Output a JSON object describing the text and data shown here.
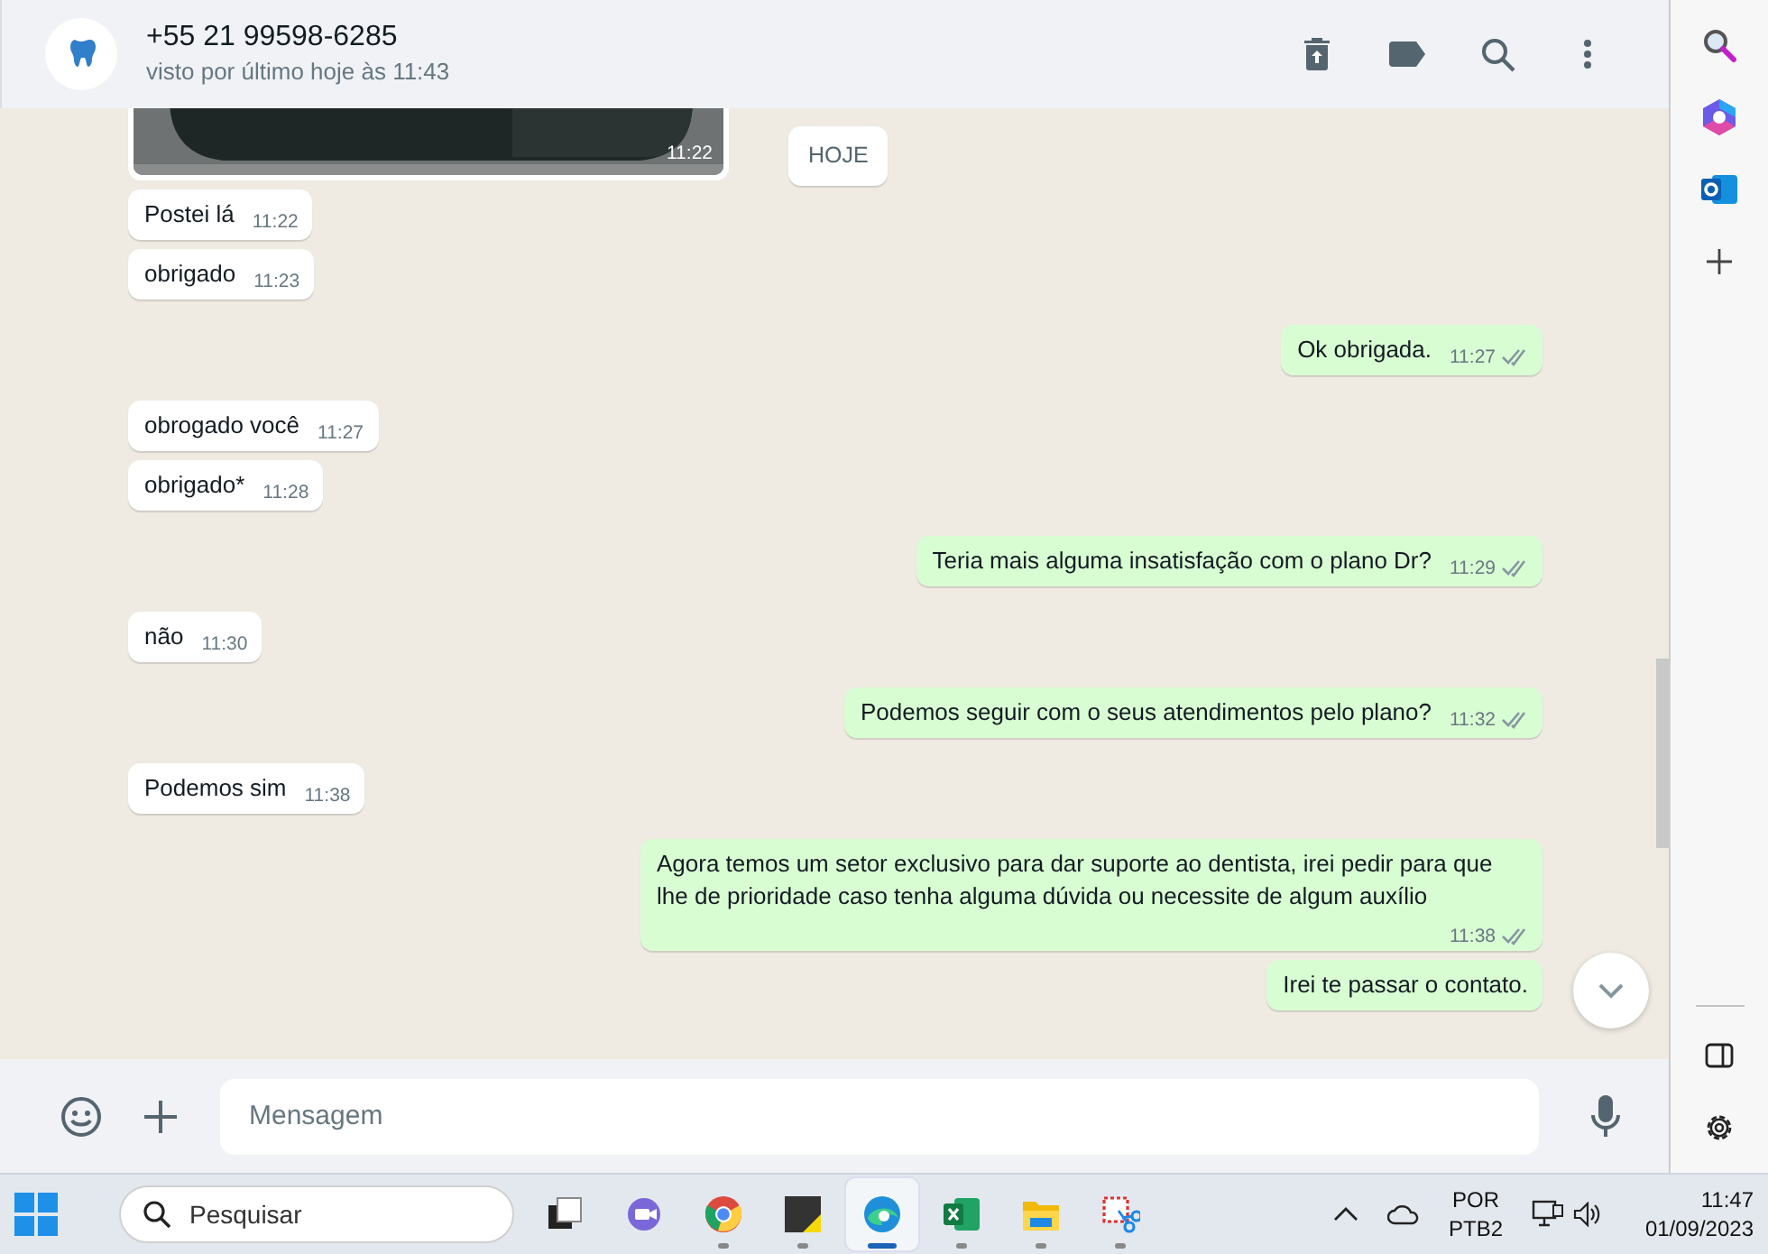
{
  "header": {
    "contact": "+55 21 99598-6285",
    "status": "visto por último hoje às 11:43"
  },
  "date_chip": "HOJE",
  "messages": [
    {
      "outgoing": false,
      "time": "11:22"
    },
    {
      "kind": "text",
      "outgoing": false,
      "text": "Postei lá",
      "time": "11:22"
    },
    {
      "kind": "text",
      "outgoing": false,
      "text": "obrigado",
      "time": "11:23"
    },
    {
      "kind": "text",
      "outgoing": true,
      "text": "Ok obrigada.",
      "time": "11:27",
      "read": false
    },
    {
      "kind": "text",
      "outgoing": false,
      "text": "obrogado você",
      "time": "11:27"
    },
    {
      "kind": "text",
      "outgoing": false,
      "text": "obrigado*",
      "time": "11:28"
    },
    {
      "kind": "text",
      "outgoing": true,
      "text": "Teria mais alguma insatisfação com o plano Dr?",
      "time": "11:29",
      "read": false
    },
    {
      "kind": "text",
      "outgoing": false,
      "text": "não",
      "time": "11:30"
    },
    {
      "kind": "text",
      "outgoing": true,
      "text": "Podemos seguir com o seus atendimentos pelo plano?",
      "time": "11:32",
      "read": false
    },
    {
      "kind": "text",
      "outgoing": false,
      "text": "Podemos sim",
      "time": "11:38"
    },
    {
      "kind": "text",
      "outgoing": true,
      "text": "Agora temos um setor exclusivo para dar suporte ao dentista, irei pedir para que lhe de prioridade caso tenha alguma dúvida ou necessite de algum auxílio",
      "time": "11:38",
      "read": false
    },
    {
      "kind": "text",
      "outgoing": true,
      "text": "Irei te passar o contato."
    }
  ],
  "composer": {
    "placeholder": "Mensagem"
  },
  "taskbar": {
    "search_placeholder": "Pesquisar",
    "apps": [
      {
        "kind": "taskview",
        "selected": false,
        "running": false
      },
      {
        "kind": "teams",
        "selected": false,
        "running": false
      },
      {
        "kind": "chrome",
        "selected": false,
        "running": true
      },
      {
        "kind": "sticky",
        "selected": false,
        "running": true
      },
      {
        "kind": "edge",
        "selected": true,
        "running": true
      },
      {
        "kind": "excel",
        "selected": false,
        "running": true
      },
      {
        "kind": "folder",
        "selected": false,
        "running": true
      },
      {
        "kind": "snip",
        "selected": false,
        "running": true
      }
    ],
    "language": "POR",
    "layout": "PTB2",
    "time": "11:47",
    "date": "01/09/2023"
  }
}
